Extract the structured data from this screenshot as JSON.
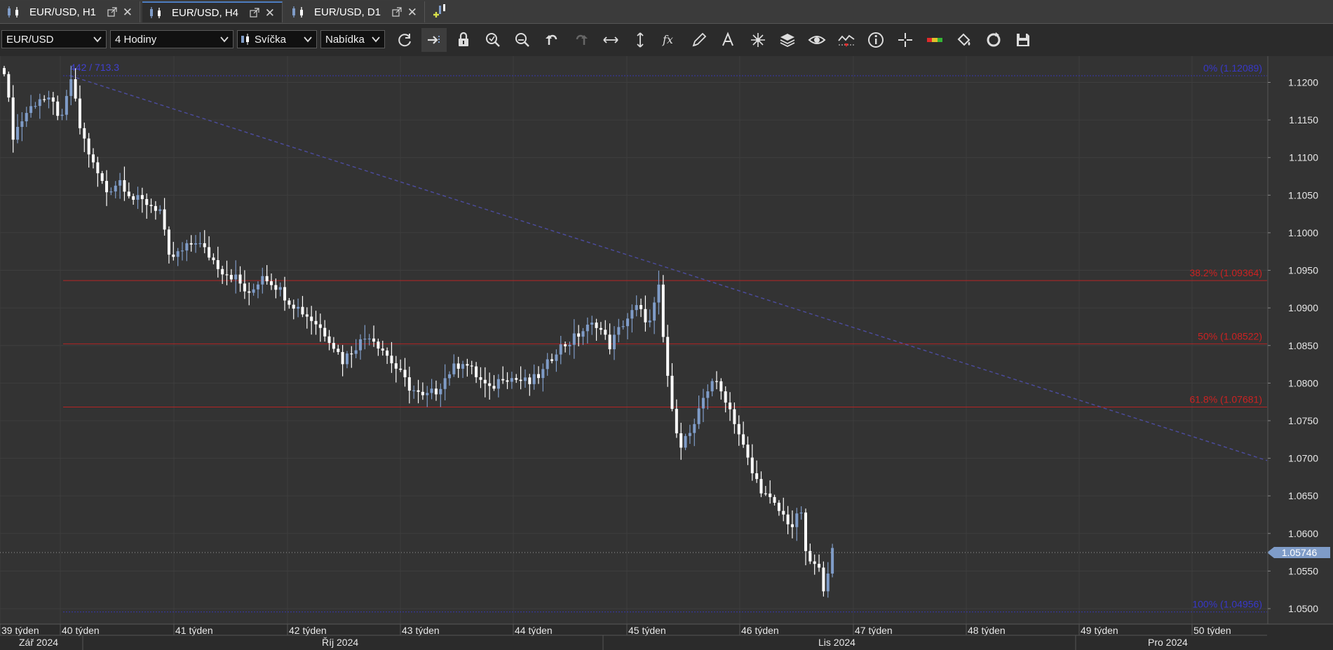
{
  "tabs": [
    {
      "label": "EUR/USD, H1",
      "active": false
    },
    {
      "label": "EUR/USD, H4",
      "active": true
    },
    {
      "label": "EUR/USD, D1",
      "active": false
    }
  ],
  "toolbar": {
    "instrument": "EUR/USD",
    "period": "4 Hodiny",
    "chart_type": "Svíčka",
    "offer_side": "Nabídka",
    "icons": [
      "refresh-icon",
      "shift-chart-icon",
      "lock-icon",
      "zoom-in-icon",
      "zoom-out-icon",
      "undo-icon",
      "redo-icon",
      "horizontal-scale-icon",
      "vertical-scale-icon",
      "indicators-icon",
      "pencil-icon",
      "text-icon",
      "star-tool-icon",
      "layers-icon",
      "eye-icon",
      "alerts-icon",
      "info-icon",
      "crosshair-icon",
      "ruler-icon",
      "paint-bucket-icon",
      "reset-icon",
      "save-icon"
    ]
  },
  "chart_data": {
    "type": "candlestick",
    "instrument": "EUR/USD",
    "timeframe": "H4",
    "y_range": [
      1.0485,
      1.1225
    ],
    "y_ticks": [
      "1.1200",
      "1.1150",
      "1.1100",
      "1.1050",
      "1.1000",
      "1.0950",
      "1.0900",
      "1.0850",
      "1.0800",
      "1.0750",
      "1.0700",
      "1.0650",
      "1.0600",
      "1.0550",
      "1.0500"
    ],
    "x_week_labels": [
      "39 týden",
      "40 týden",
      "41 týden",
      "42 týden",
      "43 týden",
      "44 týden",
      "45 týden",
      "46 týden",
      "47 týden",
      "48 týden",
      "49 týden",
      "50 týden"
    ],
    "x_month_labels": [
      "Zář 2024",
      "Říj 2024",
      "Lis 2024",
      "Pro 2024"
    ],
    "fib_header": "442 / 713.3",
    "fib_levels": [
      {
        "label": "0% (1.12089)",
        "value": 1.12089,
        "color": "#3838c8"
      },
      {
        "label": "38.2% (1.09364)",
        "value": 1.09364,
        "color": "#cc2222"
      },
      {
        "label": "50% (1.08522)",
        "value": 1.08522,
        "color": "#cc2222"
      },
      {
        "label": "61.8% (1.07681)",
        "value": 1.07681,
        "color": "#cc2222"
      },
      {
        "label": "100% (1.04956)",
        "value": 1.04956,
        "color": "#3838c8"
      }
    ],
    "current_price": "1.05746",
    "trendline": {
      "from": 1.12089,
      "to": 1.0697
    },
    "bull_color": "#7f9cc8",
    "bear_color": "#ffffff",
    "anchors": [
      [
        0,
        1.1218
      ],
      [
        2,
        1.113
      ],
      [
        5,
        1.116
      ],
      [
        8,
        1.118
      ],
      [
        11,
        1.117
      ],
      [
        13,
        1.115
      ],
      [
        15,
        1.1205
      ],
      [
        17,
        1.114
      ],
      [
        20,
        1.109
      ],
      [
        23,
        1.1055
      ],
      [
        26,
        1.107
      ],
      [
        29,
        1.1045
      ],
      [
        32,
        1.104
      ],
      [
        35,
        1.103
      ],
      [
        37,
        1.0965
      ],
      [
        40,
        1.0975
      ],
      [
        43,
        1.099
      ],
      [
        46,
        1.097
      ],
      [
        49,
        1.095
      ],
      [
        52,
        1.094
      ],
      [
        55,
        1.0915
      ],
      [
        58,
        1.0945
      ],
      [
        61,
        1.093
      ],
      [
        64,
        1.091
      ],
      [
        67,
        1.0895
      ],
      [
        70,
        1.088
      ],
      [
        73,
        1.086
      ],
      [
        76,
        1.083
      ],
      [
        79,
        1.085
      ],
      [
        82,
        1.0865
      ],
      [
        85,
        1.0845
      ],
      [
        88,
        1.082
      ],
      [
        91,
        1.0795
      ],
      [
        94,
        1.078
      ],
      [
        97,
        1.079
      ],
      [
        100,
        1.0815
      ],
      [
        103,
        1.083
      ],
      [
        106,
        1.081
      ],
      [
        109,
        1.079
      ],
      [
        112,
        1.081
      ],
      [
        115,
        1.0805
      ],
      [
        118,
        1.08
      ],
      [
        121,
        1.0815
      ],
      [
        124,
        1.0845
      ],
      [
        127,
        1.0855
      ],
      [
        130,
        1.087
      ],
      [
        133,
        1.088
      ],
      [
        136,
        1.085
      ],
      [
        139,
        1.088
      ],
      [
        142,
        1.09
      ],
      [
        145,
        1.088
      ],
      [
        147,
        1.0925
      ],
      [
        148,
        1.086
      ],
      [
        150,
        1.076
      ],
      [
        152,
        1.072
      ],
      [
        155,
        1.074
      ],
      [
        157,
        1.078
      ],
      [
        159,
        1.0805
      ],
      [
        162,
        1.078
      ],
      [
        164,
        1.075
      ],
      [
        166,
        1.0715
      ],
      [
        168,
        1.068
      ],
      [
        171,
        1.065
      ],
      [
        174,
        1.063
      ],
      [
        177,
        1.061
      ],
      [
        179,
        1.063
      ],
      [
        180,
        1.057
      ],
      [
        183,
        1.055
      ],
      [
        184,
        1.053
      ],
      [
        186,
        1.0575
      ]
    ]
  }
}
